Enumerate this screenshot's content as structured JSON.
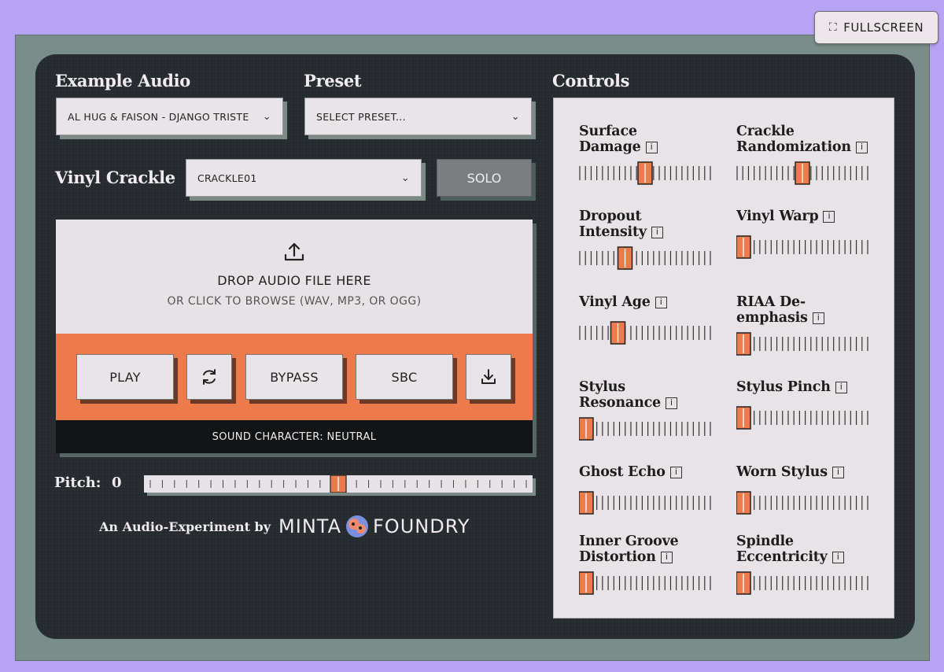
{
  "fullscreen": {
    "label": "FULLSCREEN",
    "icon": "expand-icon"
  },
  "example_audio": {
    "heading": "Example Audio",
    "value": "AL HUG & FAISON - DJANGO TRISTE"
  },
  "preset": {
    "heading": "Preset",
    "value": "SELECT PRESET..."
  },
  "vinyl_crackle": {
    "heading": "Vinyl Crackle",
    "value": "CRACKLE01",
    "solo_label": "SOLO"
  },
  "drop_zone": {
    "title": "DROP AUDIO FILE HERE",
    "subtitle": "OR CLICK TO BROWSE (WAV, MP3, OR OGG)"
  },
  "transport": {
    "play": "PLAY",
    "bypass": "BYPASS",
    "sbc": "SBC"
  },
  "status": "SOUND CHARACTER: NEUTRAL",
  "pitch": {
    "label": "Pitch:",
    "value": "0",
    "fraction": 0.5
  },
  "credit": {
    "text": "An Audio-Experiment by",
    "brand_left": "MINTA",
    "brand_right": "FOUNDRY"
  },
  "controls_heading": "Controls",
  "controls": [
    {
      "line1": "Surface",
      "line2": "Damage",
      "value": 0.5
    },
    {
      "line1": "Crackle",
      "line2": "Randomization",
      "value": 0.5
    },
    {
      "line1": "Dropout",
      "line2": "Intensity",
      "value": 0.33
    },
    {
      "line1": "Vinyl Warp",
      "line2": "",
      "value": 0.0
    },
    {
      "line1": "Vinyl Age",
      "line2": "",
      "value": 0.27
    },
    {
      "line1": "RIAA De-",
      "line2": "emphasis",
      "value": 0.0
    },
    {
      "line1": "Stylus",
      "line2": "Resonance",
      "value": 0.0
    },
    {
      "line1": "Stylus Pinch",
      "line2": "",
      "value": 0.0
    },
    {
      "line1": "Ghost Echo",
      "line2": "",
      "value": 0.0
    },
    {
      "line1": "Worn Stylus",
      "line2": "",
      "value": 0.0
    },
    {
      "line1": "Inner Groove",
      "line2": "Distortion",
      "value": 0.0
    },
    {
      "line1": "Spindle",
      "line2": "Eccentricity",
      "value": 0.0
    }
  ],
  "colors": {
    "accent": "#ec7a4a",
    "panel": "#262b2f",
    "background": "#b7a3f3"
  }
}
